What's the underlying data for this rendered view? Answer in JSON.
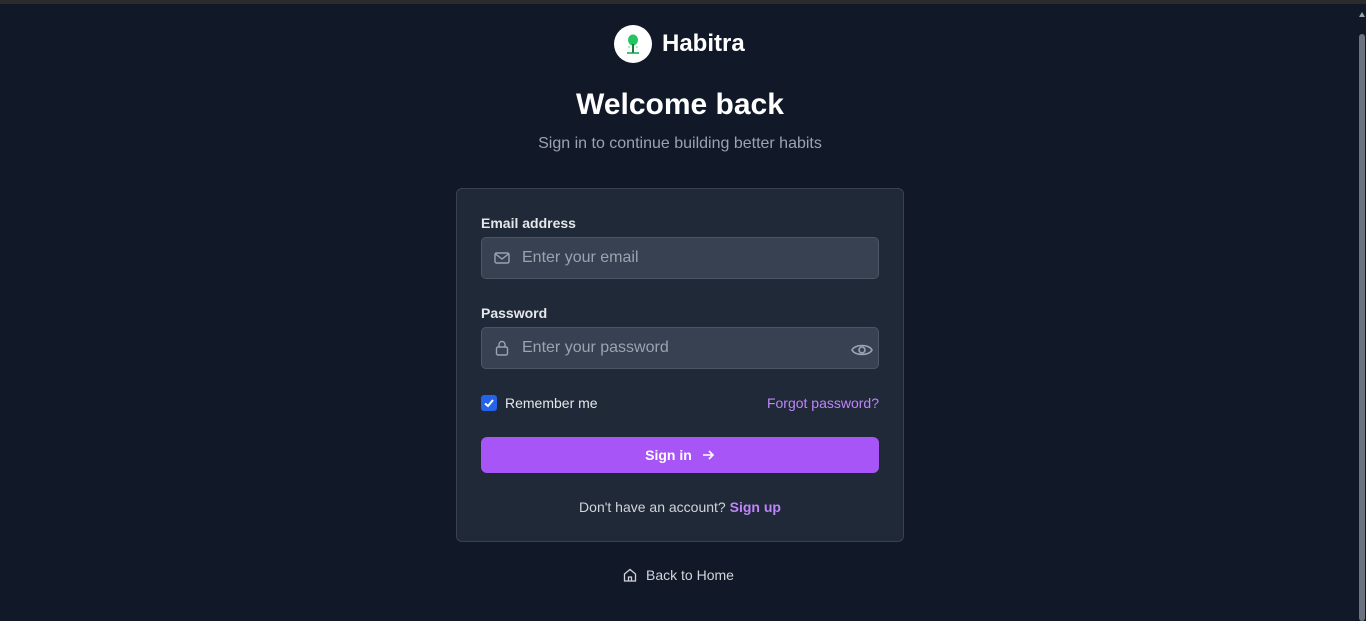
{
  "brand": {
    "name": "Habitra",
    "logo_icon": "tree-icon"
  },
  "heading": {
    "title": "Welcome back",
    "subtitle": "Sign in to continue building better habits"
  },
  "form": {
    "email": {
      "label": "Email address",
      "placeholder": "Enter your email",
      "value": "",
      "icon": "mail-icon"
    },
    "password": {
      "label": "Password",
      "placeholder": "Enter your password",
      "value": "",
      "icon": "lock-icon",
      "toggle_icon": "eye-icon"
    },
    "remember": {
      "label": "Remember me",
      "checked": true
    },
    "forgot_label": "Forgot password?",
    "submit_label": "Sign in",
    "submit_icon": "arrow-right-icon",
    "signup_prompt": "Don't have an account?",
    "signup_label": "Sign up"
  },
  "footer": {
    "back_label": "Back to Home",
    "back_icon": "home-icon"
  },
  "colors": {
    "background": "#111827",
    "card": "#1f2937",
    "accent": "#a855f7",
    "link": "#c084fc",
    "checkbox": "#2563eb"
  }
}
